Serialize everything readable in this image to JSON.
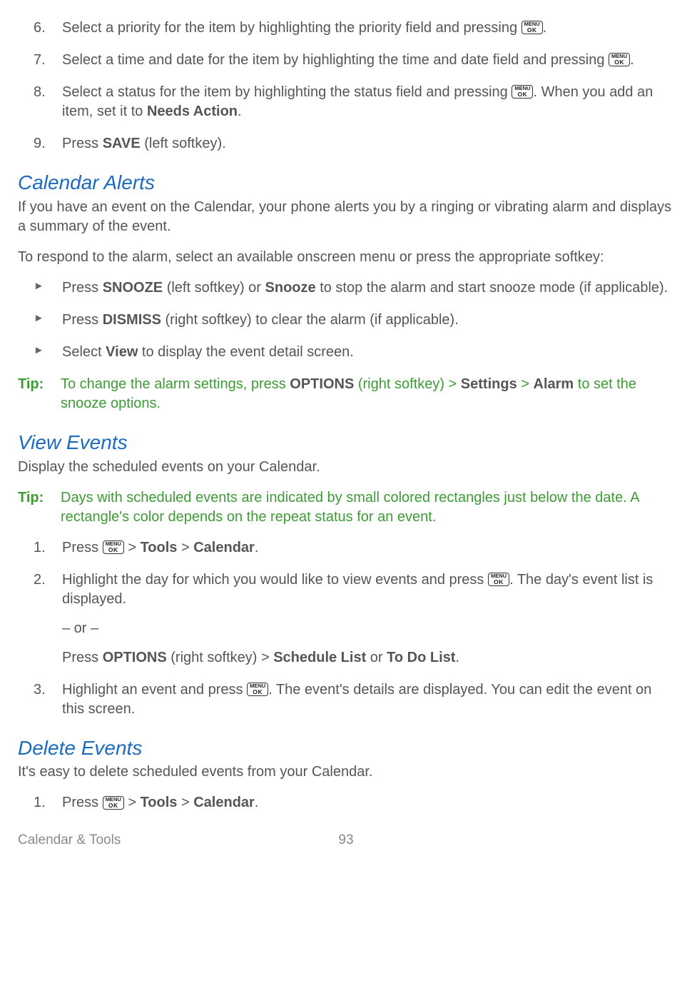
{
  "steps_top": {
    "s6_a": "Select a priority for the item by highlighting the priority field and pressing ",
    "s6_b": ".",
    "s7_a": "Select a time and date for the item by highlighting the time and date field and pressing ",
    "s7_b": ".",
    "s8_a": "Select a status for the item by highlighting the status field and pressing ",
    "s8_b": ". When you add an item, set it to ",
    "s8_bold": "Needs Action",
    "s8_c": ".",
    "s9_a": "Press ",
    "s9_bold": "SAVE",
    "s9_b": " (left softkey)."
  },
  "calendar_alerts": {
    "heading": "Calendar Alerts",
    "intro": "If you have an event on the Calendar, your phone alerts you by a ringing or vibrating alarm and displays a summary of the event.",
    "respond": "To respond to the alarm, select an available onscreen menu or press the appropriate softkey:",
    "b1_a": "Press ",
    "b1_s1": "SNOOZE",
    "b1_b": " (left softkey) or ",
    "b1_s2": "Snooze",
    "b1_c": " to stop the alarm and start snooze mode (if applicable).",
    "b2_a": "Press ",
    "b2_s1": "DISMISS",
    "b2_b": " (right softkey) to clear the alarm (if applicable).",
    "b3_a": "Select ",
    "b3_s1": "View",
    "b3_b": " to display the event detail screen."
  },
  "tips": {
    "label": "Tip:",
    "t1_a": "To change the alarm settings, press ",
    "t1_s1": "OPTIONS",
    "t1_b": " (right softkey) > ",
    "t1_s2": "Settings",
    "t1_c": " > ",
    "t1_s3": "Alarm",
    "t1_d": " to set the snooze options.",
    "t2": "Days with scheduled events are indicated by small colored rectangles just below the date. A rectangle's color depends on the repeat status for an event."
  },
  "view_events": {
    "heading": "View Events",
    "intro": "Display the scheduled events on your Calendar.",
    "s1_a": "Press ",
    "s1_b": " > ",
    "s1_tools": "Tools",
    "s1_c": " > ",
    "s1_cal": "Calendar",
    "s1_d": ".",
    "s2_a": "Highlight the day for which you would like to view events and press ",
    "s2_b": ". The day's event list is displayed.",
    "s2_or": "– or –",
    "s2_alt_a": "Press ",
    "s2_alt_s1": "OPTIONS",
    "s2_alt_b": " (right softkey) > ",
    "s2_alt_s2": "Schedule List",
    "s2_alt_c": " or ",
    "s2_alt_s3": "To Do List",
    "s2_alt_d": ".",
    "s3_a": "Highlight an event and press ",
    "s3_b": ". The event's details are displayed. You can edit the event on this screen."
  },
  "delete_events": {
    "heading": "Delete Events",
    "intro": "It's easy to delete scheduled events from your Calendar.",
    "s1_a": "Press ",
    "s1_b": " > ",
    "s1_tools": "Tools",
    "s1_c": " > ",
    "s1_cal": "Calendar",
    "s1_d": "."
  },
  "key": {
    "line1": "MENU",
    "line2": "OK"
  },
  "footer": {
    "section": "Calendar & Tools",
    "page": "93"
  },
  "numbers": {
    "n6": "6.",
    "n7": "7.",
    "n8": "8.",
    "n9": "9.",
    "n1": "1.",
    "n2": "2.",
    "n3": "3."
  }
}
